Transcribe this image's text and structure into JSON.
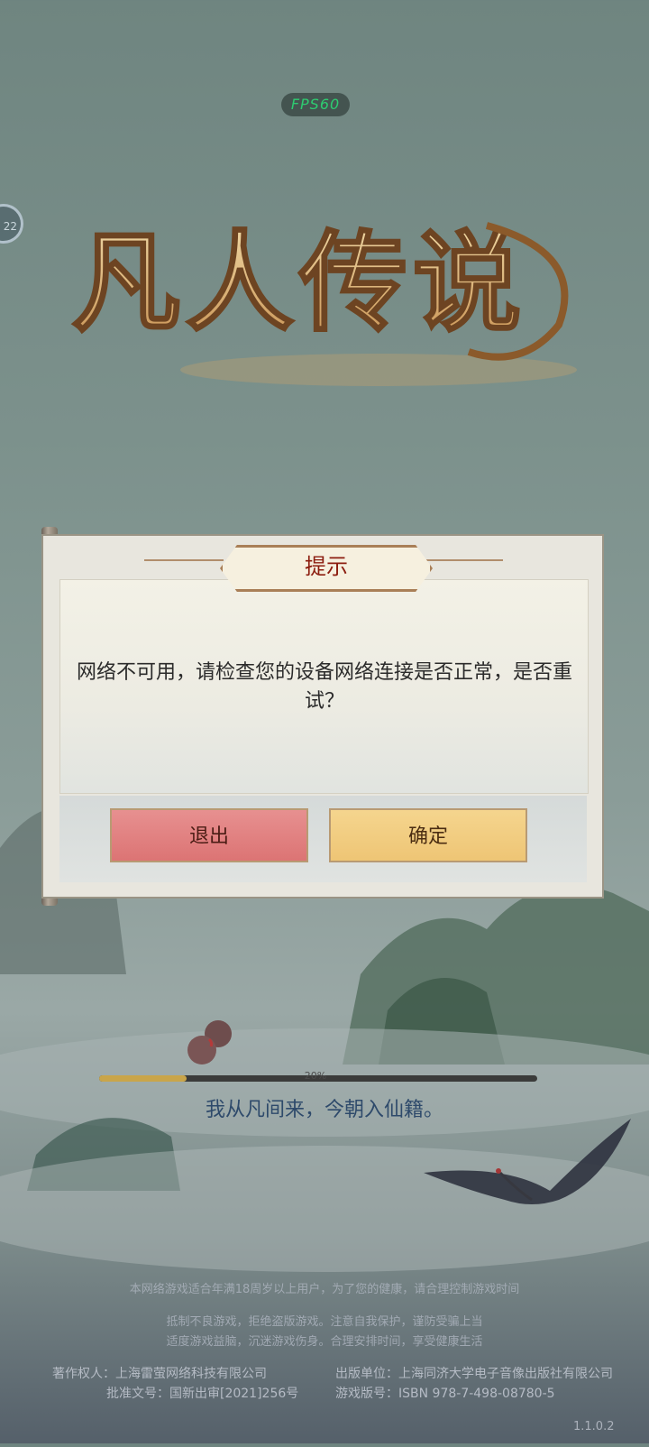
{
  "fps": "FPS60",
  "side_widget": {
    "text": "22"
  },
  "logo": {
    "text": "凡人传说"
  },
  "dialog": {
    "title": "提示",
    "message": "网络不可用，请检查您的设备网络连接是否正常，是否重试？",
    "buttons": {
      "exit": "退出",
      "confirm": "确定"
    }
  },
  "loading": {
    "progress": 0.2,
    "percent_text": "20%",
    "tagline": "我从凡间来，今朝入仙籍。"
  },
  "footer": {
    "line1": "本网络游戏适合年满18周岁以上用户，为了您的健康，请合理控制游戏时间",
    "line2": "抵制不良游戏，拒绝盗版游戏。注意自我保护，谨防受骗上当",
    "line3": "适度游戏益脑，沉迷游戏伤身。合理安排时间，享受健康生活",
    "copyright": "著作权人：上海雷萤网络科技有限公司",
    "publisher": "出版单位：上海同济大学电子音像出版社有限公司",
    "approval": "批准文号：国新出审[2021]256号",
    "isbn": "游戏版号：ISBN 978-7-498-08780-5"
  },
  "version": "1.1.0.2",
  "colors": {
    "exit_button": "#dc7474",
    "confirm_button": "#eec575",
    "title_text": "#8c1d0f",
    "progress_fill": "#c9a54a"
  }
}
